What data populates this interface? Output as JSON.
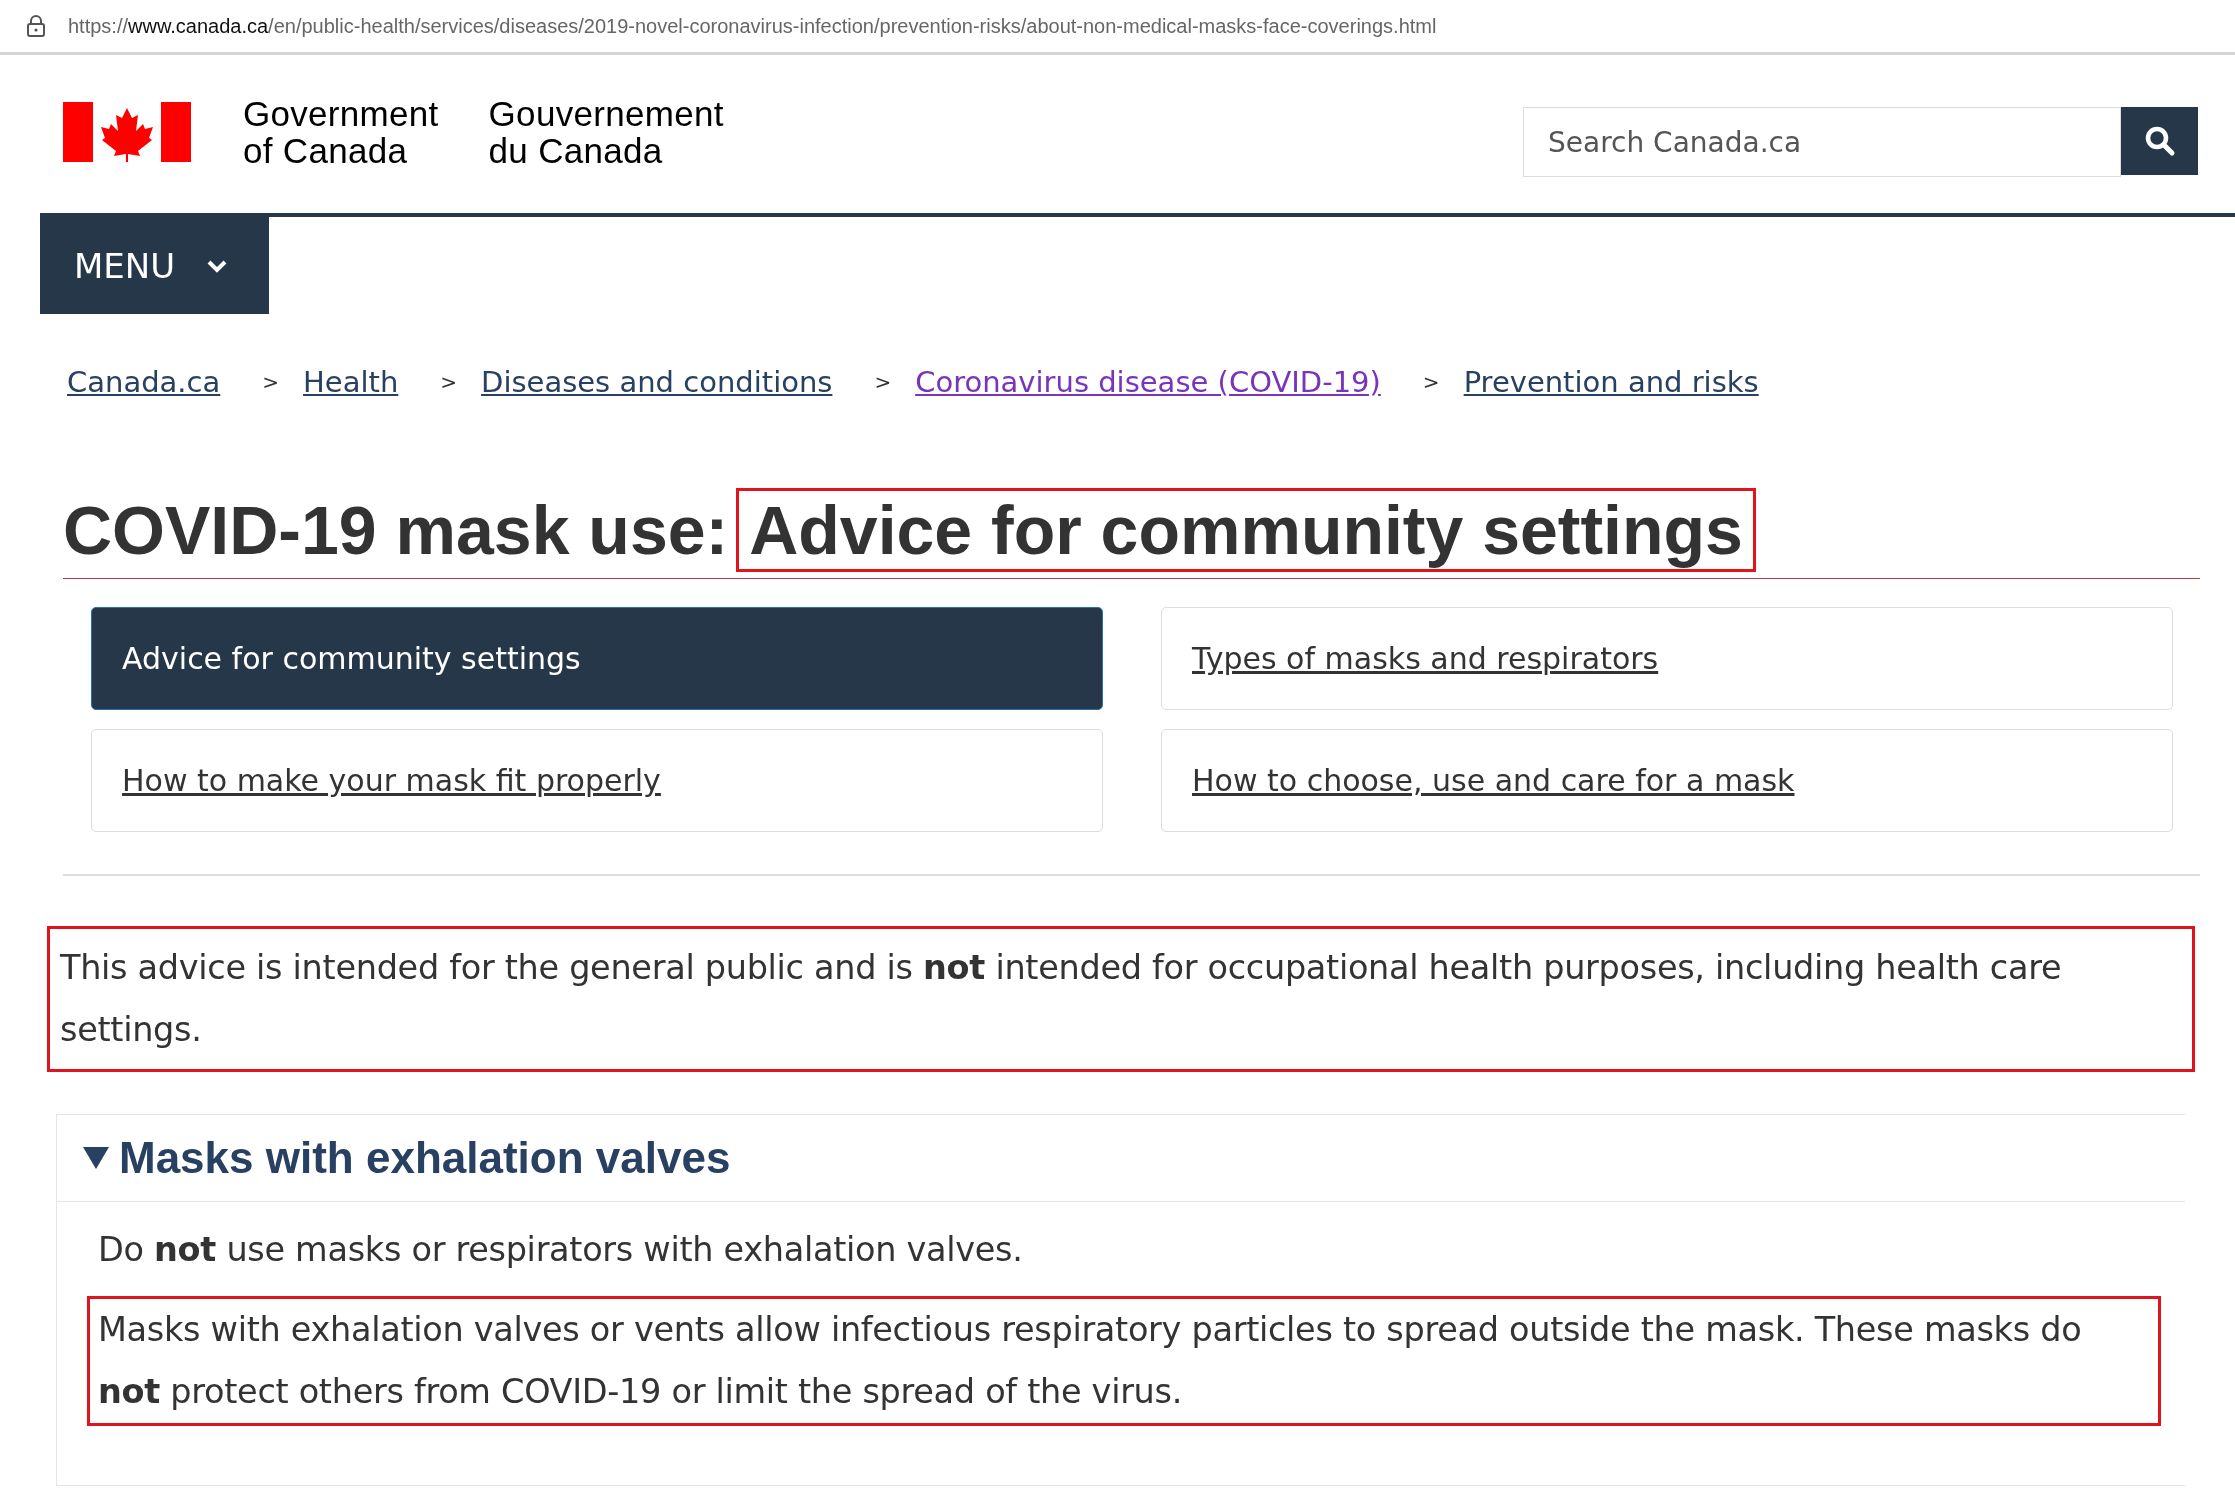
{
  "address_bar": {
    "url": [
      {
        "text": "https://",
        "emphasis": false
      },
      {
        "text": "www.canada.ca",
        "emphasis": true
      },
      {
        "text": "/en/public-health/services/diseases/2019-novel-coronavirus-infection/prevention-risks/about-non-medical-masks-face-coverings.html",
        "emphasis": false
      }
    ]
  },
  "header": {
    "wordmarks": [
      {
        "lines": [
          "Government",
          "of Canada"
        ]
      },
      {
        "lines": [
          "Gouvernement",
          "du Canada"
        ]
      }
    ],
    "search": {
      "placeholder": "Search Canada.ca"
    }
  },
  "menu": {
    "label": "MENU",
    "expanded": false
  },
  "breadcrumbs": [
    {
      "label": "Canada.ca",
      "visited": false
    },
    {
      "label": "Health",
      "visited": false
    },
    {
      "label": "Diseases and conditions",
      "visited": false
    },
    {
      "label": "Coronavirus disease (COVID-19)",
      "visited": true
    },
    {
      "label": "Prevention and risks",
      "visited": false
    }
  ],
  "breadcrumb_separator": ">",
  "title": {
    "prefix": "COVID-19 mask use:",
    "subtitle": "Advice for community settings",
    "highlighted": true
  },
  "tabs": [
    {
      "label": "Advice for community settings",
      "selected": true
    },
    {
      "label": "Types of masks and respirators",
      "selected": false
    },
    {
      "label": "How to make your mask fit properly",
      "selected": false
    },
    {
      "label": "How to choose, use and care for a mask",
      "selected": false
    }
  ],
  "notice": {
    "text": "This advice is intended for the general public and is **not** intended for occupational health purposes, including health care settings.",
    "highlighted": true
  },
  "details": {
    "summary": "Masks with exhalation valves",
    "expanded": true,
    "paragraphs": [
      {
        "text": "Do **not** use masks or respirators with exhalation valves.",
        "highlighted": false
      },
      {
        "text": "Masks with exhalation valves or vents allow infectious respiratory particles to spread outside the mask. These masks do **not** protect others from COVID-19 or limit the spread of the virus.",
        "highlighted": true
      }
    ]
  }
}
